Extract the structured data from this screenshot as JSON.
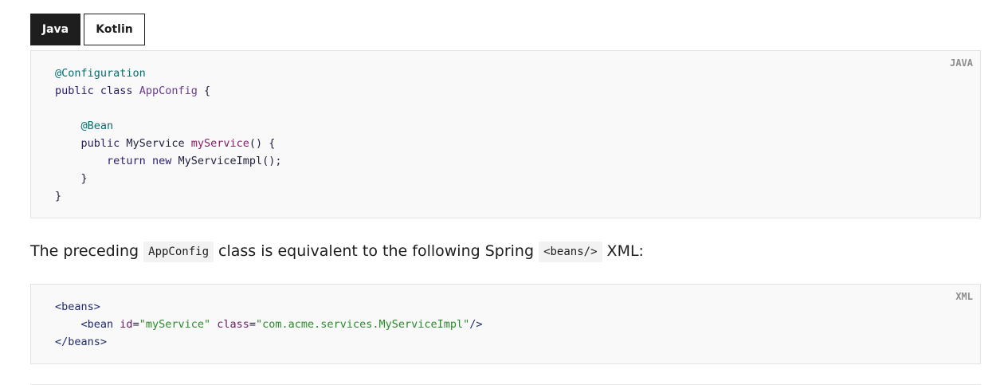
{
  "tabs": [
    {
      "label": "Java",
      "active": true
    },
    {
      "label": "Kotlin",
      "active": false
    }
  ],
  "java_block": {
    "lang": "JAVA",
    "lines": [
      [
        {
          "t": "@Configuration",
          "c": "anno"
        }
      ],
      [
        {
          "t": "public ",
          "c": "kw"
        },
        {
          "t": "class ",
          "c": "kw"
        },
        {
          "t": "AppConfig",
          "c": "cls"
        },
        {
          "t": " {",
          "c": "plain"
        }
      ],
      [],
      [
        {
          "t": "    ",
          "c": "plain"
        },
        {
          "t": "@Bean",
          "c": "anno"
        }
      ],
      [
        {
          "t": "    ",
          "c": "plain"
        },
        {
          "t": "public ",
          "c": "kw"
        },
        {
          "t": "MyService ",
          "c": "plain"
        },
        {
          "t": "myService",
          "c": "fn"
        },
        {
          "t": "() {",
          "c": "plain"
        }
      ],
      [
        {
          "t": "        ",
          "c": "plain"
        },
        {
          "t": "return ",
          "c": "kw"
        },
        {
          "t": "new ",
          "c": "kw"
        },
        {
          "t": "MyServiceImpl();",
          "c": "plain"
        }
      ],
      [
        {
          "t": "    }",
          "c": "plain"
        }
      ],
      [
        {
          "t": "}",
          "c": "plain"
        }
      ]
    ]
  },
  "prose": {
    "part1": "The preceding ",
    "code1": "AppConfig",
    "part2": " class is equivalent to the following Spring ",
    "code2": "<beans/>",
    "part3": " XML:"
  },
  "xml_block": {
    "lang": "XML",
    "lines": [
      [
        {
          "t": "<beans>",
          "c": "tag"
        }
      ],
      [
        {
          "t": "    ",
          "c": "plain"
        },
        {
          "t": "<bean ",
          "c": "tag"
        },
        {
          "t": "id",
          "c": "attr"
        },
        {
          "t": "=",
          "c": "plain"
        },
        {
          "t": "\"myService\"",
          "c": "str"
        },
        {
          "t": " ",
          "c": "plain"
        },
        {
          "t": "class",
          "c": "attr"
        },
        {
          "t": "=",
          "c": "plain"
        },
        {
          "t": "\"com.acme.services.MyServiceImpl\"",
          "c": "str"
        },
        {
          "t": "/>",
          "c": "tag"
        }
      ],
      [
        {
          "t": "</beans>",
          "c": "tag"
        }
      ]
    ]
  }
}
